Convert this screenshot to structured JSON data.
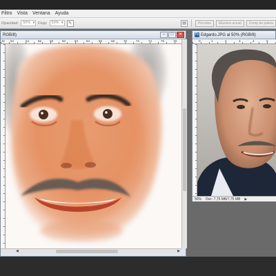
{
  "menubar": {
    "items": [
      "Filtro",
      "Vista",
      "Ventana",
      "Ayuda"
    ]
  },
  "options": {
    "opacity_label": "Opacidad:",
    "opacity_value": "50%",
    "flow_label": "Flujo:",
    "flow_value": "50%",
    "button1": "Pinceles",
    "button2": "Muestra actual",
    "button3": "Comp de paleta"
  },
  "doc1": {
    "title_suffix": "RGB/8)",
    "ruler_labels": [
      "32",
      "52",
      "54",
      "56",
      "58",
      "60",
      "62",
      "64",
      "66",
      "68",
      "70",
      "72",
      "74",
      "76",
      "78"
    ],
    "scroll_fraction": 0.35
  },
  "doc2": {
    "title": "Edgardo.JPG al 50% (RGB/8)",
    "ruler_labels": [
      "0",
      "1",
      "2",
      "3",
      "4",
      "5"
    ],
    "zoom": "50%",
    "doc_info": "Doc: 7,75 MB/7,75 MB"
  },
  "colors": {
    "skin_paint": "#e8a47c",
    "workspace": "#6a6a6a",
    "titlebar": "#dfe6ee"
  }
}
